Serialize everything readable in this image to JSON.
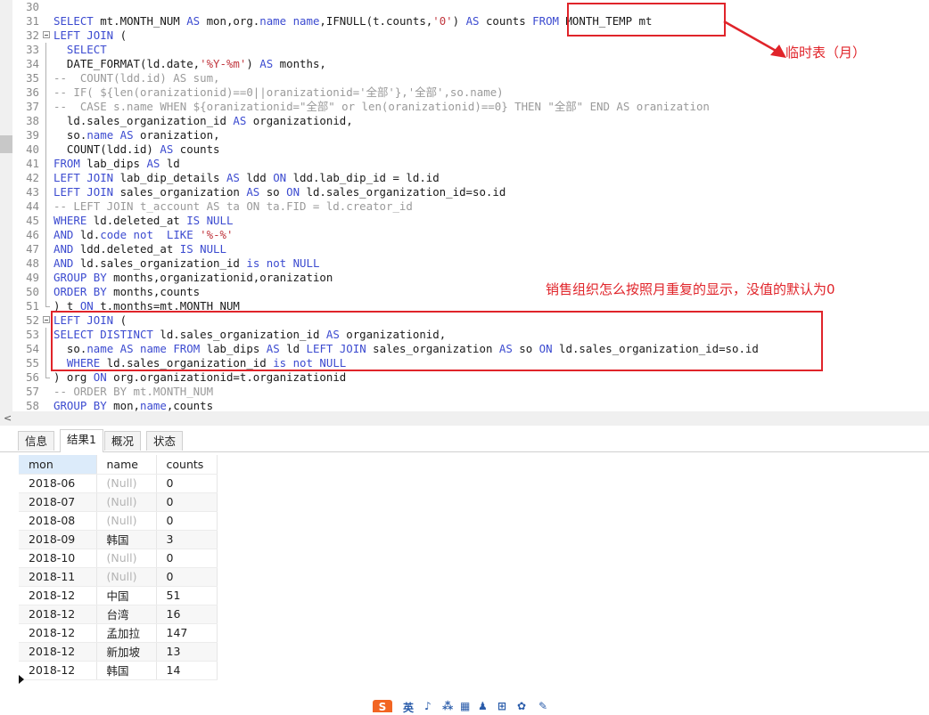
{
  "editor": {
    "lines": [
      {
        "n": "30",
        "segs": []
      },
      {
        "n": "31",
        "segs": [
          {
            "t": "SELECT",
            "c": "kw"
          },
          {
            "t": " mt.MONTH_NUM "
          },
          {
            "t": "AS",
            "c": "kw"
          },
          {
            "t": " mon,org."
          },
          {
            "t": "name",
            "c": "kw"
          },
          {
            "t": " "
          },
          {
            "t": "name",
            "c": "kw"
          },
          {
            "t": ",IFNULL(t.counts,"
          },
          {
            "t": "'0'",
            "c": "str"
          },
          {
            "t": ") "
          },
          {
            "t": "AS",
            "c": "kw"
          },
          {
            "t": " counts "
          },
          {
            "t": "FROM",
            "c": "kw"
          },
          {
            "t": " MONTH_TEMP mt"
          }
        ]
      },
      {
        "n": "32",
        "fold": "start",
        "segs": [
          {
            "t": "LEFT JOIN",
            "c": "kw"
          },
          {
            "t": " ("
          }
        ]
      },
      {
        "n": "33",
        "segs": [
          {
            "t": "  "
          },
          {
            "t": "SELECT",
            "c": "kw"
          }
        ]
      },
      {
        "n": "34",
        "segs": [
          {
            "t": "  DATE_FORMAT(ld.date,"
          },
          {
            "t": "'%Y-%m'",
            "c": "str"
          },
          {
            "t": ") "
          },
          {
            "t": "AS",
            "c": "kw"
          },
          {
            "t": " months,"
          }
        ]
      },
      {
        "n": "35",
        "segs": [
          {
            "t": "--  COUNT(ldd.id) AS sum,",
            "c": "cm"
          }
        ]
      },
      {
        "n": "36",
        "segs": [
          {
            "t": "-- IF( ${len(oranizationid)==0||oranizationid='全部'},'全部',so.name)",
            "c": "cm"
          }
        ]
      },
      {
        "n": "37",
        "segs": [
          {
            "t": "--  CASE s.name WHEN ${oranizationid=\"全部\" or len(oranizationid)==0} THEN \"全部\" END AS oranization",
            "c": "cm"
          }
        ]
      },
      {
        "n": "38",
        "segs": [
          {
            "t": "  ld.sales_organization_id "
          },
          {
            "t": "AS",
            "c": "kw"
          },
          {
            "t": " organizationid,"
          }
        ]
      },
      {
        "n": "39",
        "segs": [
          {
            "t": "  so."
          },
          {
            "t": "name",
            "c": "kw"
          },
          {
            "t": " "
          },
          {
            "t": "AS",
            "c": "kw"
          },
          {
            "t": " oranization,"
          }
        ]
      },
      {
        "n": "40",
        "segs": [
          {
            "t": "  COUNT(ldd.id) "
          },
          {
            "t": "AS",
            "c": "kw"
          },
          {
            "t": " counts"
          }
        ]
      },
      {
        "n": "41",
        "segs": [
          {
            "t": "FROM",
            "c": "kw"
          },
          {
            "t": " lab_dips "
          },
          {
            "t": "AS",
            "c": "kw"
          },
          {
            "t": " ld"
          }
        ]
      },
      {
        "n": "42",
        "segs": [
          {
            "t": "LEFT JOIN",
            "c": "kw"
          },
          {
            "t": " lab_dip_details "
          },
          {
            "t": "AS",
            "c": "kw"
          },
          {
            "t": " ldd "
          },
          {
            "t": "ON",
            "c": "kw"
          },
          {
            "t": " ldd.lab_dip_id = ld.id"
          }
        ]
      },
      {
        "n": "43",
        "segs": [
          {
            "t": "LEFT JOIN",
            "c": "kw"
          },
          {
            "t": " sales_organization "
          },
          {
            "t": "AS",
            "c": "kw"
          },
          {
            "t": " so "
          },
          {
            "t": "ON",
            "c": "kw"
          },
          {
            "t": " ld.sales_organization_id=so.id"
          }
        ]
      },
      {
        "n": "44",
        "segs": [
          {
            "t": "-- LEFT JOIN t_account AS ta ON ta.FID = ld.creator_id",
            "c": "cm"
          }
        ]
      },
      {
        "n": "45",
        "segs": [
          {
            "t": "WHERE",
            "c": "kw"
          },
          {
            "t": " ld.deleted_at "
          },
          {
            "t": "IS NULL",
            "c": "kw"
          }
        ]
      },
      {
        "n": "46",
        "segs": [
          {
            "t": "AND",
            "c": "kw"
          },
          {
            "t": " ld."
          },
          {
            "t": "code",
            "c": "kw"
          },
          {
            "t": " "
          },
          {
            "t": "not",
            "c": "kw"
          },
          {
            "t": "  "
          },
          {
            "t": "LIKE",
            "c": "kw"
          },
          {
            "t": " "
          },
          {
            "t": "'%-%'",
            "c": "str"
          }
        ]
      },
      {
        "n": "47",
        "segs": [
          {
            "t": "AND",
            "c": "kw"
          },
          {
            "t": " ldd.deleted_at "
          },
          {
            "t": "IS NULL",
            "c": "kw"
          }
        ]
      },
      {
        "n": "48",
        "segs": [
          {
            "t": "AND",
            "c": "kw"
          },
          {
            "t": " ld.sales_organization_id "
          },
          {
            "t": "is not NULL",
            "c": "kw"
          }
        ]
      },
      {
        "n": "49",
        "segs": [
          {
            "t": "GROUP BY",
            "c": "kw"
          },
          {
            "t": " months,organizationid,oranization"
          }
        ]
      },
      {
        "n": "50",
        "segs": [
          {
            "t": "ORDER BY",
            "c": "kw"
          },
          {
            "t": " months,counts"
          }
        ]
      },
      {
        "n": "51",
        "fold": "end",
        "segs": [
          {
            "t": ") t "
          },
          {
            "t": "ON",
            "c": "kw"
          },
          {
            "t": " t.months=mt.MONTH_NUM"
          }
        ]
      },
      {
        "n": "52",
        "fold": "start",
        "segs": [
          {
            "t": "LEFT JOIN",
            "c": "kw"
          },
          {
            "t": " ("
          }
        ]
      },
      {
        "n": "53",
        "segs": [
          {
            "t": "SELECT DISTINCT",
            "c": "kw"
          },
          {
            "t": " ld.sales_organization_id "
          },
          {
            "t": "AS",
            "c": "kw"
          },
          {
            "t": " organizationid,"
          }
        ]
      },
      {
        "n": "54",
        "segs": [
          {
            "t": "  so."
          },
          {
            "t": "name",
            "c": "kw"
          },
          {
            "t": " "
          },
          {
            "t": "AS",
            "c": "kw"
          },
          {
            "t": " "
          },
          {
            "t": "name",
            "c": "kw"
          },
          {
            "t": " "
          },
          {
            "t": "FROM",
            "c": "kw"
          },
          {
            "t": " lab_dips "
          },
          {
            "t": "AS",
            "c": "kw"
          },
          {
            "t": " ld "
          },
          {
            "t": "LEFT JOIN",
            "c": "kw"
          },
          {
            "t": " sales_organization "
          },
          {
            "t": "AS",
            "c": "kw"
          },
          {
            "t": " so "
          },
          {
            "t": "ON",
            "c": "kw"
          },
          {
            "t": " ld.sales_organization_id=so.id"
          }
        ]
      },
      {
        "n": "55",
        "segs": [
          {
            "t": "  "
          },
          {
            "t": "WHERE",
            "c": "kw"
          },
          {
            "t": " ld.sales_organization_id "
          },
          {
            "t": "is not NULL",
            "c": "kw"
          }
        ]
      },
      {
        "n": "56",
        "fold": "end",
        "segs": [
          {
            "t": ") org "
          },
          {
            "t": "ON",
            "c": "kw"
          },
          {
            "t": " org.organizationid=t.organizationid"
          }
        ]
      },
      {
        "n": "57",
        "segs": [
          {
            "t": "-- ORDER BY mt.MONTH_NUM",
            "c": "cm"
          }
        ]
      },
      {
        "n": "58",
        "segs": [
          {
            "t": "GROUP BY",
            "c": "kw"
          },
          {
            "t": " mon,"
          },
          {
            "t": "name",
            "c": "kw"
          },
          {
            "t": ",counts"
          }
        ]
      }
    ]
  },
  "annotations": {
    "temp_table_note": "临时表（月）",
    "question_note": "销售组织怎么按照月重复的显示，没值的默认为0"
  },
  "tabs": [
    {
      "label": "信息",
      "active": false
    },
    {
      "label": "结果1",
      "active": true
    },
    {
      "label": "概况",
      "active": false
    },
    {
      "label": "状态",
      "active": false
    }
  ],
  "result": {
    "columns": [
      "mon",
      "name",
      "counts"
    ],
    "rows": [
      [
        "2018-06",
        "(Null)",
        "0"
      ],
      [
        "2018-07",
        "(Null)",
        "0"
      ],
      [
        "2018-08",
        "(Null)",
        "0"
      ],
      [
        "2018-09",
        "韩国",
        "3"
      ],
      [
        "2018-10",
        "(Null)",
        "0"
      ],
      [
        "2018-11",
        "(Null)",
        "0"
      ],
      [
        "2018-12",
        "中国",
        "51"
      ],
      [
        "2018-12",
        "台湾",
        "16"
      ],
      [
        "2018-12",
        "孟加拉",
        "147"
      ],
      [
        "2018-12",
        "新加坡",
        "13"
      ],
      [
        "2018-12",
        "韩国",
        "14"
      ]
    ]
  },
  "ime": {
    "logo": "S",
    "items": [
      "英",
      "♪",
      "⁂",
      "▦",
      "♟",
      "⊞",
      "✿",
      "✎"
    ]
  },
  "colors": {
    "keyword": "#3c4bd0",
    "string": "#c0363e",
    "comment": "#9a9a9a",
    "annotation": "#e0242a"
  }
}
